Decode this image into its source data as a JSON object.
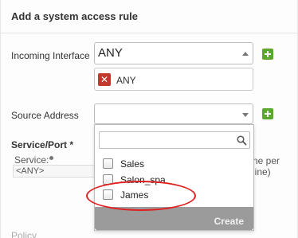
{
  "dialog": {
    "title": "Add a system access rule"
  },
  "incoming_interface": {
    "label": "Incoming Interface",
    "selected_value": "ANY",
    "chip_label": "ANY"
  },
  "source_address": {
    "label": "Source Address",
    "selected_value": "",
    "search_placeholder": ""
  },
  "service_port": {
    "section_title": "Service/Port *",
    "service_label": "Service:",
    "service_value": "<ANY>",
    "hint_fragment": "ne per line)"
  },
  "dropdown_options": [
    {
      "label": "Sales",
      "checked": false
    },
    {
      "label": "Salon_spa",
      "checked": false
    },
    {
      "label": "James",
      "checked": false
    }
  ],
  "create_button": {
    "label": "Create"
  },
  "policy": {
    "label": "Policy"
  },
  "colors": {
    "plus_green": "#5aa82d",
    "remove_red": "#c0392b",
    "highlight_ellipse": "#e02020",
    "create_bar": "#9b9b9b"
  }
}
